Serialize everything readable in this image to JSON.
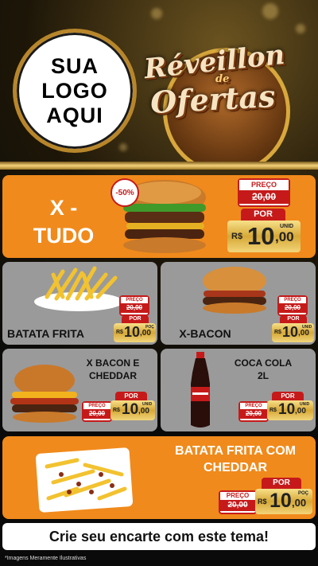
{
  "header": {
    "logo_lines": [
      "SUA",
      "LOGO",
      "AQUI"
    ],
    "title_line1": "Réveillon",
    "title_de": "de",
    "title_line2": "Ofertas"
  },
  "colors": {
    "orange": "#f08a1c",
    "grey": "#9a9a9a",
    "red": "#c61a1a",
    "gold": "#d6a837"
  },
  "featured": {
    "name": "X - TUDO",
    "discount": "-50%",
    "old_label": "PREÇO",
    "old_price": "20,00",
    "por_label": "POR",
    "currency": "R$",
    "new_price_int": "10",
    "new_price_dec": ",00",
    "unit": "UNID"
  },
  "products": [
    {
      "name": "BATATA FRITA",
      "old_label": "PREÇO",
      "old_price": "20,00",
      "por_label": "POR",
      "currency": "R$",
      "new_price_int": "10",
      "new_price_dec": ",00",
      "unit": "POÇ"
    },
    {
      "name": "X-BACON",
      "old_label": "PREÇO",
      "old_price": "20,00",
      "por_label": "POR",
      "currency": "R$",
      "new_price_int": "10",
      "new_price_dec": ",00",
      "unit": "UNID"
    },
    {
      "name": "X BACON E CHEDDAR",
      "old_label": "PREÇO",
      "old_price": "20,00",
      "por_label": "POR",
      "currency": "R$",
      "new_price_int": "10",
      "new_price_dec": ",00",
      "unit": "UNID"
    },
    {
      "name": "COCA COLA 2L",
      "old_label": "PREÇO",
      "old_price": "20,00",
      "por_label": "POR",
      "currency": "R$",
      "new_price_int": "10",
      "new_price_dec": ",00",
      "unit": "UNID"
    }
  ],
  "bottom": {
    "name": "BATATA FRITA COM CHEDDAR",
    "old_label": "PREÇO",
    "old_price": "20,00",
    "por_label": "POR",
    "currency": "R$",
    "new_price_int": "10",
    "new_price_dec": ",00",
    "unit": "POÇ"
  },
  "cta": "Crie seu encarte com este tema!",
  "disclaimer": "*Imagens Meramente Ilustrativas"
}
